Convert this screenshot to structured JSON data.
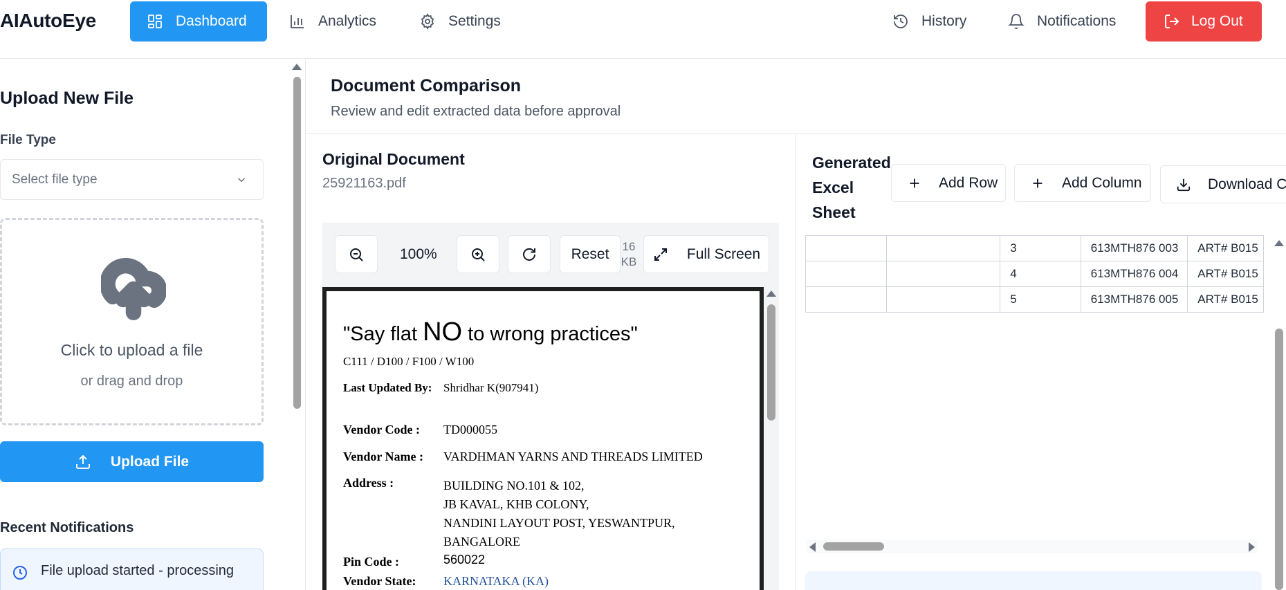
{
  "app": {
    "brand": "AIAutoEye"
  },
  "nav": {
    "dashboard": "Dashboard",
    "analytics": "Analytics",
    "settings": "Settings",
    "history": "History",
    "notifications": "Notifications",
    "logout": "Log Out"
  },
  "sidebar": {
    "title": "Upload New File",
    "file_type_label": "File Type",
    "file_type_placeholder": "Select file type",
    "dropzone_main": "Click to upload a file",
    "dropzone_sub": "or drag and drop",
    "upload_button": "Upload File",
    "recent_title": "Recent Notifications",
    "notifications": [
      {
        "text": "File upload started - processing"
      }
    ]
  },
  "main": {
    "title": "Document Comparison",
    "subtitle": "Review and edit extracted data before approval"
  },
  "original": {
    "title": "Original Document",
    "filename": "25921163.pdf",
    "toolbar": {
      "zoom": "100%",
      "reset": "Reset",
      "size": "16 KB",
      "fullscreen": "Full Screen"
    },
    "document": {
      "slogan_before": "\"Say flat ",
      "slogan_big": "NO",
      "slogan_after": " to wrong practices\"",
      "codes": "C111 / D100 / F100 / W100",
      "last_updated_label": "Last Updated By:",
      "last_updated_value": "Shridhar  K(907941)",
      "vendor_code_label": "Vendor Code :",
      "vendor_code_value": "TD000055",
      "vendor_name_label": "Vendor Name :",
      "vendor_name_value": "VARDHMAN YARNS AND THREADS LIMITED",
      "address_label": "Address :",
      "address_lines": [
        "BUILDING NO.101 & 102,",
        "JB KAVAL, KHB COLONY,",
        "NANDINI LAYOUT POST, YESWANTPUR,",
        "BANGALORE"
      ],
      "pin_label": "Pin Code :",
      "pin_value": "560022",
      "state_label": "Vendor State:",
      "state_value": "KARNATAKA (KA)"
    }
  },
  "excel": {
    "title_lines": [
      "Generated",
      "Excel",
      "Sheet"
    ],
    "add_row": "Add Row",
    "add_column": "Add Column",
    "download": "Download C",
    "rows": [
      {
        "c1": "",
        "c2": "",
        "c3": "3",
        "c4": "613MTH876 003",
        "c5": "ART# B015"
      },
      {
        "c1": "",
        "c2": "",
        "c3": "4",
        "c4": "613MTH876 004",
        "c5": "ART# B015"
      },
      {
        "c1": "",
        "c2": "",
        "c3": "5",
        "c4": "613MTH876 005",
        "c5": "ART# B015"
      }
    ]
  },
  "colors": {
    "primary": "#2196f3",
    "danger": "#ef4444",
    "info_bg": "#eff6ff"
  }
}
